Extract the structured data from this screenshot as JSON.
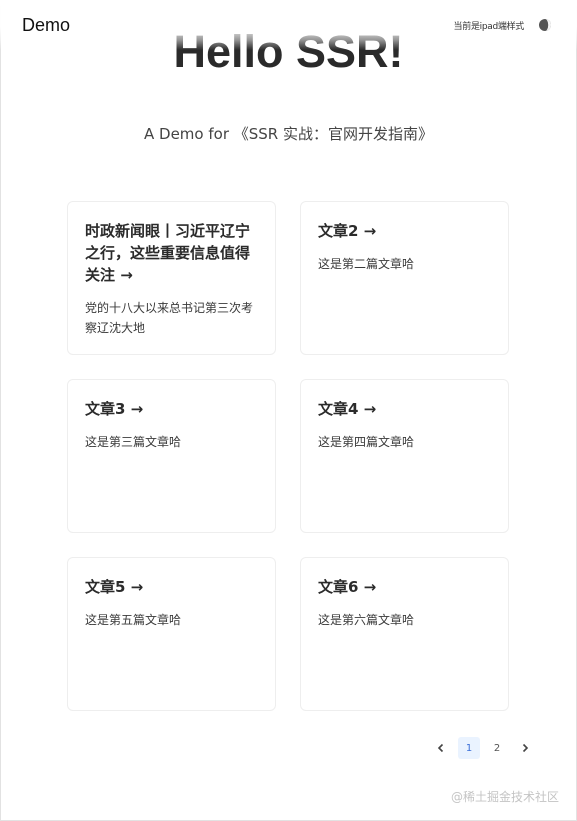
{
  "header": {
    "brand": "Demo",
    "mode_text": "当前是ipad端样式",
    "theme_icon": "moon-icon"
  },
  "hero": {
    "title": "Hello SSR!",
    "subtitle": "A Demo for 《SSR 实战：官网开发指南》"
  },
  "articles": [
    {
      "title": "时政新闻眼丨习近平辽宁之行，这些重要信息值得关注 →",
      "desc": "党的十八大以来总书记第三次考察辽沈大地"
    },
    {
      "title": "文章2 →",
      "desc": "这是第二篇文章哈"
    },
    {
      "title": "文章3 →",
      "desc": "这是第三篇文章哈"
    },
    {
      "title": "文章4 →",
      "desc": "这是第四篇文章哈"
    },
    {
      "title": "文章5 →",
      "desc": "这是第五篇文章哈"
    },
    {
      "title": "文章6 →",
      "desc": "这是第六篇文章哈"
    }
  ],
  "pagination": {
    "prev_icon": "chevron-left-icon",
    "next_icon": "chevron-right-icon",
    "pages": [
      "1",
      "2"
    ],
    "current": "1"
  },
  "watermark": "@稀土掘金技术社区",
  "colors": {
    "active_page_bg": "#eaf3ff",
    "active_page_text": "#3b6fd8"
  }
}
